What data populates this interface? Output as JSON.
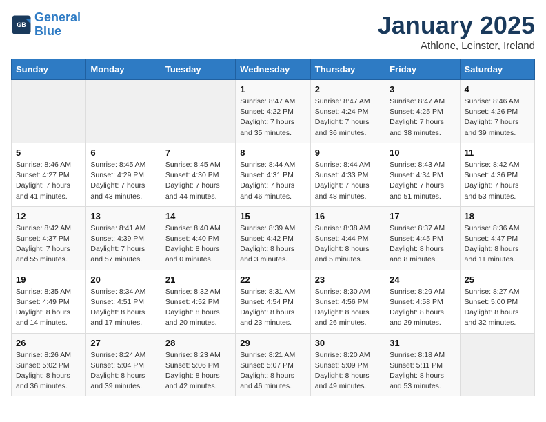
{
  "header": {
    "logo_line1": "General",
    "logo_line2": "Blue",
    "month": "January 2025",
    "location": "Athlone, Leinster, Ireland"
  },
  "days_of_week": [
    "Sunday",
    "Monday",
    "Tuesday",
    "Wednesday",
    "Thursday",
    "Friday",
    "Saturday"
  ],
  "weeks": [
    [
      {
        "day": "",
        "sunrise": "",
        "sunset": "",
        "daylight": ""
      },
      {
        "day": "",
        "sunrise": "",
        "sunset": "",
        "daylight": ""
      },
      {
        "day": "",
        "sunrise": "",
        "sunset": "",
        "daylight": ""
      },
      {
        "day": "1",
        "sunrise": "Sunrise: 8:47 AM",
        "sunset": "Sunset: 4:22 PM",
        "daylight": "Daylight: 7 hours and 35 minutes."
      },
      {
        "day": "2",
        "sunrise": "Sunrise: 8:47 AM",
        "sunset": "Sunset: 4:24 PM",
        "daylight": "Daylight: 7 hours and 36 minutes."
      },
      {
        "day": "3",
        "sunrise": "Sunrise: 8:47 AM",
        "sunset": "Sunset: 4:25 PM",
        "daylight": "Daylight: 7 hours and 38 minutes."
      },
      {
        "day": "4",
        "sunrise": "Sunrise: 8:46 AM",
        "sunset": "Sunset: 4:26 PM",
        "daylight": "Daylight: 7 hours and 39 minutes."
      }
    ],
    [
      {
        "day": "5",
        "sunrise": "Sunrise: 8:46 AM",
        "sunset": "Sunset: 4:27 PM",
        "daylight": "Daylight: 7 hours and 41 minutes."
      },
      {
        "day": "6",
        "sunrise": "Sunrise: 8:45 AM",
        "sunset": "Sunset: 4:29 PM",
        "daylight": "Daylight: 7 hours and 43 minutes."
      },
      {
        "day": "7",
        "sunrise": "Sunrise: 8:45 AM",
        "sunset": "Sunset: 4:30 PM",
        "daylight": "Daylight: 7 hours and 44 minutes."
      },
      {
        "day": "8",
        "sunrise": "Sunrise: 8:44 AM",
        "sunset": "Sunset: 4:31 PM",
        "daylight": "Daylight: 7 hours and 46 minutes."
      },
      {
        "day": "9",
        "sunrise": "Sunrise: 8:44 AM",
        "sunset": "Sunset: 4:33 PM",
        "daylight": "Daylight: 7 hours and 48 minutes."
      },
      {
        "day": "10",
        "sunrise": "Sunrise: 8:43 AM",
        "sunset": "Sunset: 4:34 PM",
        "daylight": "Daylight: 7 hours and 51 minutes."
      },
      {
        "day": "11",
        "sunrise": "Sunrise: 8:42 AM",
        "sunset": "Sunset: 4:36 PM",
        "daylight": "Daylight: 7 hours and 53 minutes."
      }
    ],
    [
      {
        "day": "12",
        "sunrise": "Sunrise: 8:42 AM",
        "sunset": "Sunset: 4:37 PM",
        "daylight": "Daylight: 7 hours and 55 minutes."
      },
      {
        "day": "13",
        "sunrise": "Sunrise: 8:41 AM",
        "sunset": "Sunset: 4:39 PM",
        "daylight": "Daylight: 7 hours and 57 minutes."
      },
      {
        "day": "14",
        "sunrise": "Sunrise: 8:40 AM",
        "sunset": "Sunset: 4:40 PM",
        "daylight": "Daylight: 8 hours and 0 minutes."
      },
      {
        "day": "15",
        "sunrise": "Sunrise: 8:39 AM",
        "sunset": "Sunset: 4:42 PM",
        "daylight": "Daylight: 8 hours and 3 minutes."
      },
      {
        "day": "16",
        "sunrise": "Sunrise: 8:38 AM",
        "sunset": "Sunset: 4:44 PM",
        "daylight": "Daylight: 8 hours and 5 minutes."
      },
      {
        "day": "17",
        "sunrise": "Sunrise: 8:37 AM",
        "sunset": "Sunset: 4:45 PM",
        "daylight": "Daylight: 8 hours and 8 minutes."
      },
      {
        "day": "18",
        "sunrise": "Sunrise: 8:36 AM",
        "sunset": "Sunset: 4:47 PM",
        "daylight": "Daylight: 8 hours and 11 minutes."
      }
    ],
    [
      {
        "day": "19",
        "sunrise": "Sunrise: 8:35 AM",
        "sunset": "Sunset: 4:49 PM",
        "daylight": "Daylight: 8 hours and 14 minutes."
      },
      {
        "day": "20",
        "sunrise": "Sunrise: 8:34 AM",
        "sunset": "Sunset: 4:51 PM",
        "daylight": "Daylight: 8 hours and 17 minutes."
      },
      {
        "day": "21",
        "sunrise": "Sunrise: 8:32 AM",
        "sunset": "Sunset: 4:52 PM",
        "daylight": "Daylight: 8 hours and 20 minutes."
      },
      {
        "day": "22",
        "sunrise": "Sunrise: 8:31 AM",
        "sunset": "Sunset: 4:54 PM",
        "daylight": "Daylight: 8 hours and 23 minutes."
      },
      {
        "day": "23",
        "sunrise": "Sunrise: 8:30 AM",
        "sunset": "Sunset: 4:56 PM",
        "daylight": "Daylight: 8 hours and 26 minutes."
      },
      {
        "day": "24",
        "sunrise": "Sunrise: 8:29 AM",
        "sunset": "Sunset: 4:58 PM",
        "daylight": "Daylight: 8 hours and 29 minutes."
      },
      {
        "day": "25",
        "sunrise": "Sunrise: 8:27 AM",
        "sunset": "Sunset: 5:00 PM",
        "daylight": "Daylight: 8 hours and 32 minutes."
      }
    ],
    [
      {
        "day": "26",
        "sunrise": "Sunrise: 8:26 AM",
        "sunset": "Sunset: 5:02 PM",
        "daylight": "Daylight: 8 hours and 36 minutes."
      },
      {
        "day": "27",
        "sunrise": "Sunrise: 8:24 AM",
        "sunset": "Sunset: 5:04 PM",
        "daylight": "Daylight: 8 hours and 39 minutes."
      },
      {
        "day": "28",
        "sunrise": "Sunrise: 8:23 AM",
        "sunset": "Sunset: 5:06 PM",
        "daylight": "Daylight: 8 hours and 42 minutes."
      },
      {
        "day": "29",
        "sunrise": "Sunrise: 8:21 AM",
        "sunset": "Sunset: 5:07 PM",
        "daylight": "Daylight: 8 hours and 46 minutes."
      },
      {
        "day": "30",
        "sunrise": "Sunrise: 8:20 AM",
        "sunset": "Sunset: 5:09 PM",
        "daylight": "Daylight: 8 hours and 49 minutes."
      },
      {
        "day": "31",
        "sunrise": "Sunrise: 8:18 AM",
        "sunset": "Sunset: 5:11 PM",
        "daylight": "Daylight: 8 hours and 53 minutes."
      },
      {
        "day": "",
        "sunrise": "",
        "sunset": "",
        "daylight": ""
      }
    ]
  ]
}
